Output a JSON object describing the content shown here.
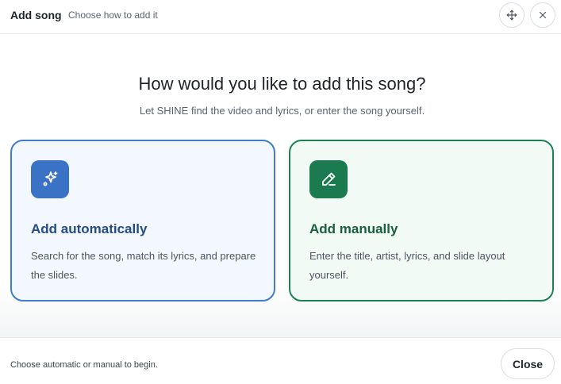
{
  "header": {
    "title": "Add song",
    "subtitle": "Choose how to add it",
    "move_icon": "move-icon",
    "close_icon": "close-icon"
  },
  "main": {
    "title": "How would you like to add this song?",
    "subtitle": "Let SHINE find the video and lyrics, or enter the song yourself.",
    "options": [
      {
        "icon": "sparkles-icon",
        "title": "Add automatically",
        "description": "Search for the song, match its lyrics, and prepare the slides.",
        "accent": "#3a72c6"
      },
      {
        "icon": "pencil-icon",
        "title": "Add manually",
        "description": "Enter the title, artist, lyrics, and slide layout yourself.",
        "accent": "#1b7a4f"
      }
    ]
  },
  "footer": {
    "hint": "Choose automatic or manual to begin.",
    "close_label": "Close"
  }
}
